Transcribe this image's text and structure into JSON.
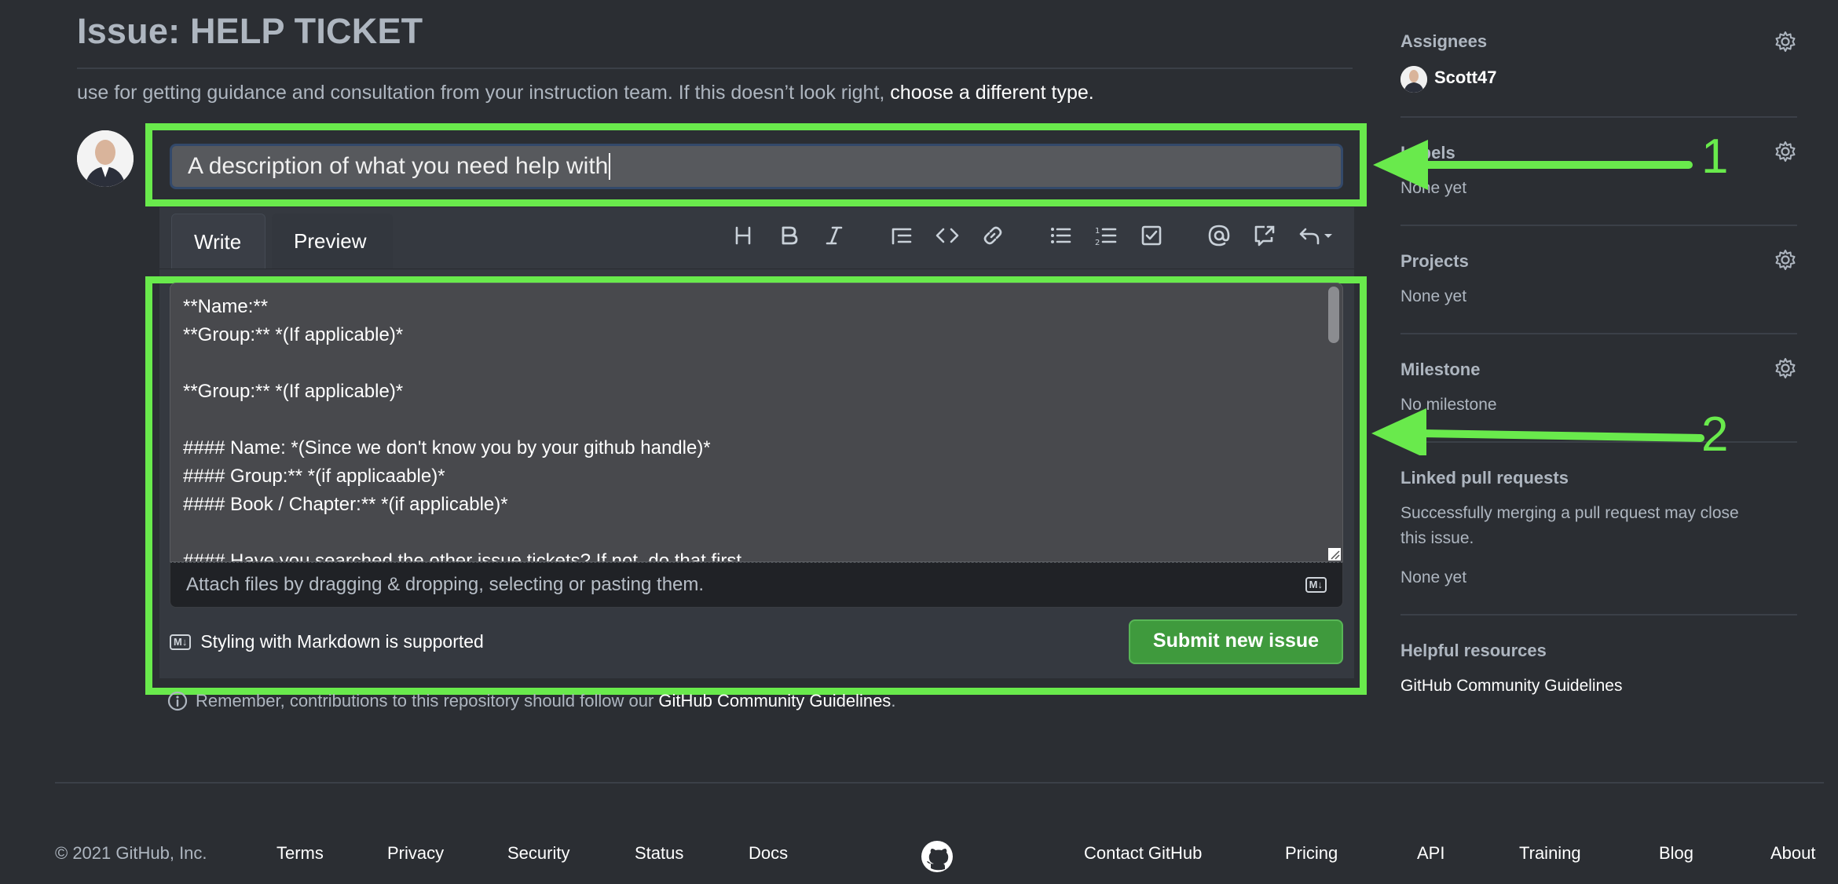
{
  "header": {
    "title": "Issue: HELP TICKET",
    "subtitle": "use for getting guidance and consultation from your instruction team. If this doesn’t look right, ",
    "subtitle_link": "choose a different type."
  },
  "issue_form": {
    "title_value": "A description of what you need help with",
    "tabs": [
      {
        "label": "Write"
      },
      {
        "label": "Preview"
      }
    ],
    "toolbar_icons": [
      "heading-icon",
      "bold-icon",
      "italic-icon",
      "quote-icon",
      "code-icon",
      "link-icon",
      "bulleted-list-icon",
      "numbered-list-icon",
      "task-list-icon",
      "mention-icon",
      "cross-reference-icon",
      "saved-replies-icon"
    ],
    "body_text": "**Name:**\n**Group:** *(If applicable)*\n\n**Group:** *(If applicable)*\n\n#### Name: *(Since we don't know you by your github handle)*\n#### Group:** *(if applicaable)*\n#### Book / Chapter:** *(if applicable)*\n\n#### Have you searched the other issue tickets? If not, do that first",
    "attach_text": "Attach files by dragging & dropping, selecting or pasting them.",
    "markdown_note": "Styling with Markdown is supported",
    "submit_label": "Submit new issue",
    "remember_text": "Remember, contributions to this repository should follow our ",
    "remember_link": "GitHub Community Guidelines",
    "remember_end": "."
  },
  "annotations": {
    "marker1": "1",
    "marker2": "2",
    "color": "#69ea4c"
  },
  "sidebar": {
    "assignees": {
      "heading": "Assignees",
      "user": "Scott47"
    },
    "labels": {
      "heading": "Labels",
      "value": "None yet"
    },
    "projects": {
      "heading": "Projects",
      "value": "None yet"
    },
    "milestone": {
      "heading": "Milestone",
      "value": "No milestone"
    },
    "linked_prs": {
      "heading": "Linked pull requests",
      "desc_line1": "Successfully merging a pull request may close",
      "desc_line2": "this issue.",
      "value": "None yet"
    },
    "resources": {
      "heading": "Helpful resources",
      "link": "GitHub Community Guidelines"
    }
  },
  "footer": {
    "copyright": "© 2021 GitHub, Inc.",
    "links": [
      "Terms",
      "Privacy",
      "Security",
      "Status",
      "Docs",
      "Contact GitHub",
      "Pricing",
      "API",
      "Training",
      "Blog",
      "About"
    ]
  }
}
